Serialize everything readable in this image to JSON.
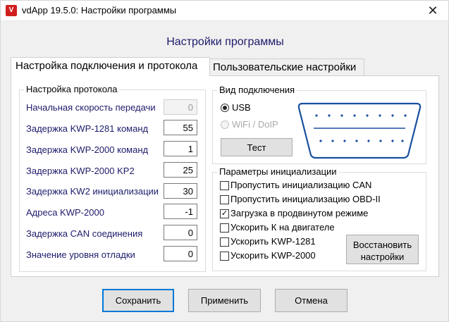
{
  "window": {
    "title": "vdApp 19.5.0:  Настройки программы",
    "close_glyph": "✕"
  },
  "heading": "Настройки программы",
  "tabs": [
    {
      "label": "Настройка подключения и протокола",
      "active": true
    },
    {
      "label": "Пользовательские настройки",
      "active": false
    }
  ],
  "protocol": {
    "title": "Настройка протокола",
    "rows": [
      {
        "label": "Начальная скорость передачи",
        "value": "0",
        "disabled": true
      },
      {
        "label": "Задержка KWP-1281 команд",
        "value": "55"
      },
      {
        "label": "Задержка KWP-2000 команд",
        "value": "1"
      },
      {
        "label": "Задержка KWP-2000 KP2",
        "value": "25"
      },
      {
        "label": "Задержка KW2 инициализации",
        "value": "30"
      },
      {
        "label": "Адреса KWP-2000",
        "value": "-1"
      },
      {
        "label": "Задержка CAN соединения",
        "value": "0"
      },
      {
        "label": "Значение уровня отладки",
        "value": "0"
      }
    ]
  },
  "connection": {
    "title": "Вид подключения",
    "options": [
      {
        "label": "USB",
        "selected": true
      },
      {
        "label": "WiFi / DoIP",
        "selected": false,
        "disabled": true
      }
    ],
    "test_button": "Тест",
    "connector_color": "#1a4fa0"
  },
  "init": {
    "title": "Параметры инициализации",
    "checkboxes": [
      {
        "label": "Пропустить инициализацию CAN",
        "checked": false
      },
      {
        "label": "Пропустить инициализацию OBD-II",
        "checked": false
      },
      {
        "label": "Загрузка в продвинутом режиме",
        "checked": true
      },
      {
        "label": "Ускорить К на двигателе",
        "checked": false
      },
      {
        "label": "Ускорить KWP-1281",
        "checked": false
      },
      {
        "label": "Ускорить KWP-2000",
        "checked": false
      }
    ],
    "restore_button": [
      "Восстановить",
      "настройки"
    ]
  },
  "footer": {
    "save": "Сохранить",
    "apply": "Применить",
    "cancel": "Отмена"
  }
}
